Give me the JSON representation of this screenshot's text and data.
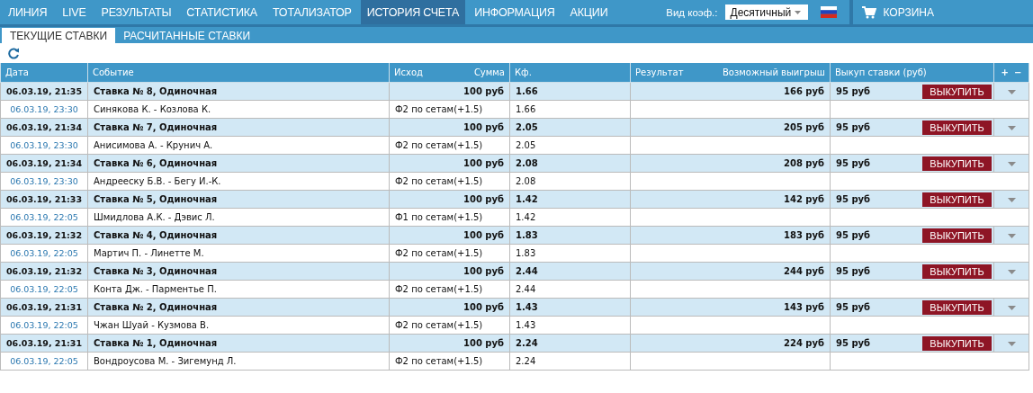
{
  "nav": {
    "items": [
      {
        "label": "ЛИНИЯ",
        "selected": false
      },
      {
        "label": "LIVE",
        "selected": false
      },
      {
        "label": "РЕЗУЛЬТАТЫ",
        "selected": false
      },
      {
        "label": "СТАТИСТИКА",
        "selected": false
      },
      {
        "label": "ТОТАЛИЗАТОР",
        "selected": false
      },
      {
        "label": "ИСТОРИЯ СЧЕТА",
        "selected": true
      },
      {
        "label": "ИНФОРМАЦИЯ",
        "selected": false
      },
      {
        "label": "АКЦИИ",
        "selected": false
      }
    ],
    "odds_label": "Вид коэф.:",
    "odds_value": "Десятичный",
    "cart": "КОРЗИНА"
  },
  "subtabs": [
    {
      "label": "ТЕКУЩИЕ СТАВКИ",
      "selected": true
    },
    {
      "label": "РАСЧИТАННЫЕ СТАВКИ",
      "selected": false
    }
  ],
  "table": {
    "columns": {
      "date": "Дата",
      "event": "Событие",
      "outcome": "Исход",
      "stake": "Сумма",
      "coef": "Кф.",
      "result": "Результат",
      "win": "Возможный выигрыш",
      "buyout": "Выкуп ставки (руб)",
      "expand": "+",
      "collapse": "−"
    },
    "bets": [
      {
        "date": "06.03.19, 21:35",
        "title": "Ставка № 8, Одиночная",
        "stake": "100 руб",
        "coef": "1.66",
        "win": "166 руб",
        "buyout": "95 руб",
        "button": "ВЫКУПИТЬ",
        "selection": {
          "date": "06.03.19, 23:30",
          "event": "Синякова К. - Козлова К.",
          "outcome": "Ф2 по сетам(+1.5)",
          "coef": "1.66"
        }
      },
      {
        "date": "06.03.19, 21:34",
        "title": "Ставка № 7, Одиночная",
        "stake": "100 руб",
        "coef": "2.05",
        "win": "205 руб",
        "buyout": "95 руб",
        "button": "ВЫКУПИТЬ",
        "selection": {
          "date": "06.03.19, 23:30",
          "event": "Анисимова А. - Крунич А.",
          "outcome": "Ф2 по сетам(+1.5)",
          "coef": "2.05"
        }
      },
      {
        "date": "06.03.19, 21:34",
        "title": "Ставка № 6, Одиночная",
        "stake": "100 руб",
        "coef": "2.08",
        "win": "208 руб",
        "buyout": "95 руб",
        "button": "ВЫКУПИТЬ",
        "selection": {
          "date": "06.03.19, 23:30",
          "event": "Андрееску Б.В. - Бегу И.-К.",
          "outcome": "Ф2 по сетам(+1.5)",
          "coef": "2.08"
        }
      },
      {
        "date": "06.03.19, 21:33",
        "title": "Ставка № 5, Одиночная",
        "stake": "100 руб",
        "coef": "1.42",
        "win": "142 руб",
        "buyout": "95 руб",
        "button": "ВЫКУПИТЬ",
        "selection": {
          "date": "06.03.19, 22:05",
          "event": "Шмидлова А.К. - Дэвис Л.",
          "outcome": "Ф1 по сетам(+1.5)",
          "coef": "1.42"
        }
      },
      {
        "date": "06.03.19, 21:32",
        "title": "Ставка № 4, Одиночная",
        "stake": "100 руб",
        "coef": "1.83",
        "win": "183 руб",
        "buyout": "95 руб",
        "button": "ВЫКУПИТЬ",
        "selection": {
          "date": "06.03.19, 22:05",
          "event": "Мартич П. - Линетте М.",
          "outcome": "Ф2 по сетам(+1.5)",
          "coef": "1.83"
        }
      },
      {
        "date": "06.03.19, 21:32",
        "title": "Ставка № 3, Одиночная",
        "stake": "100 руб",
        "coef": "2.44",
        "win": "244 руб",
        "buyout": "95 руб",
        "button": "ВЫКУПИТЬ",
        "selection": {
          "date": "06.03.19, 22:05",
          "event": "Конта Дж. - Парментье П.",
          "outcome": "Ф2 по сетам(+1.5)",
          "coef": "2.44"
        }
      },
      {
        "date": "06.03.19, 21:31",
        "title": "Ставка № 2, Одиночная",
        "stake": "100 руб",
        "coef": "1.43",
        "win": "143 руб",
        "buyout": "95 руб",
        "button": "ВЫКУПИТЬ",
        "selection": {
          "date": "06.03.19, 22:05",
          "event": "Чжан Шуай - Кузмова В.",
          "outcome": "Ф2 по сетам(+1.5)",
          "coef": "1.43"
        }
      },
      {
        "date": "06.03.19, 21:31",
        "title": "Ставка № 1, Одиночная",
        "stake": "100 руб",
        "coef": "2.24",
        "win": "224 руб",
        "buyout": "95 руб",
        "button": "ВЫКУПИТЬ",
        "selection": {
          "date": "06.03.19, 22:05",
          "event": "Вондроусова М. - Зигемунд Л.",
          "outcome": "Ф2 по сетам(+1.5)",
          "coef": "2.24"
        }
      }
    ]
  }
}
